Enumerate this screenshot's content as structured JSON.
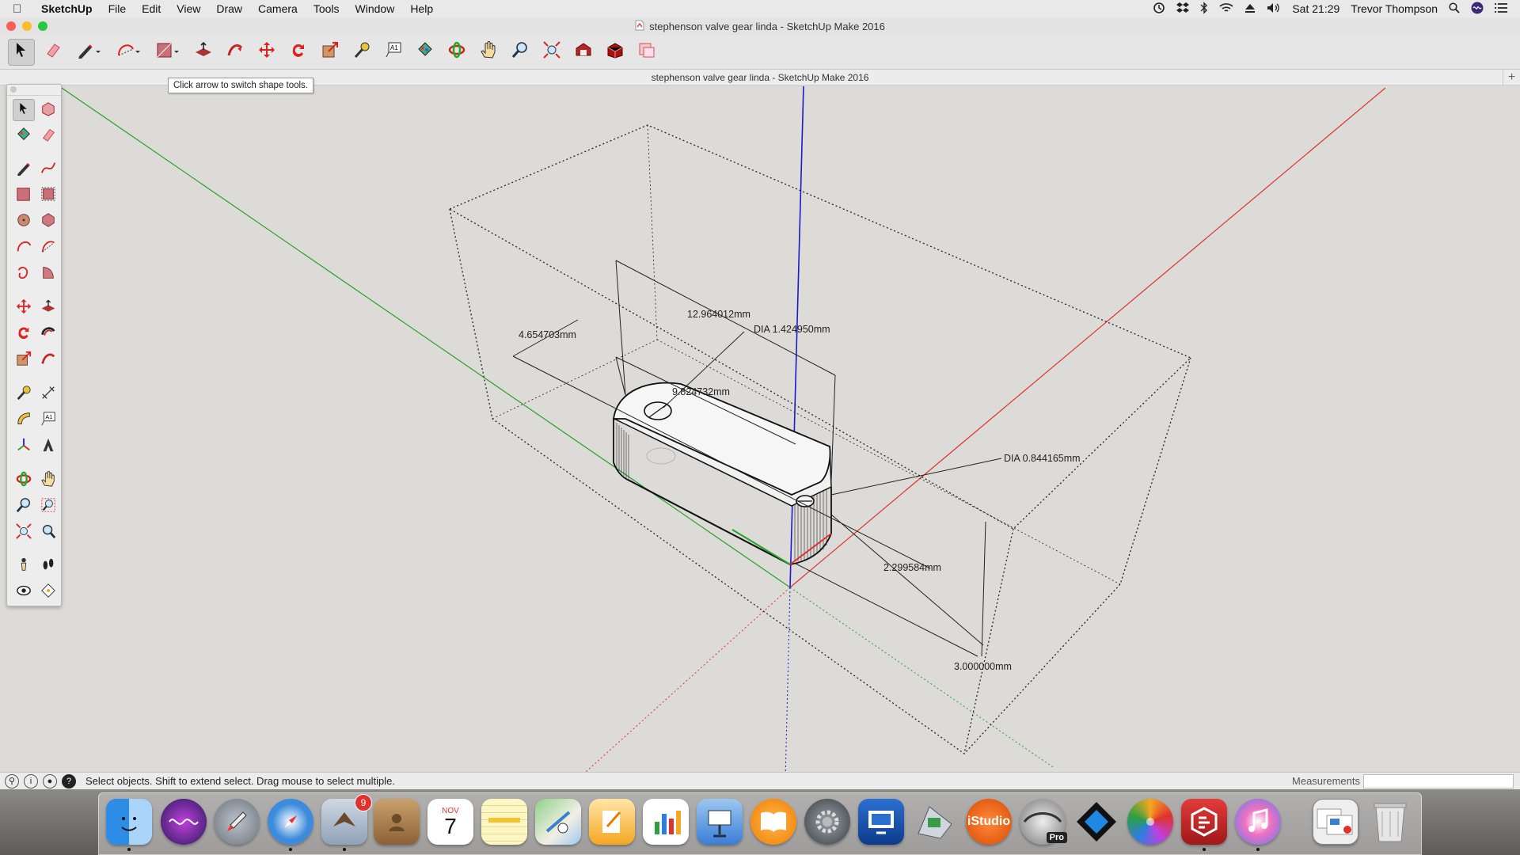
{
  "menubar": {
    "app_name": "SketchUp",
    "items": [
      "File",
      "Edit",
      "View",
      "Draw",
      "Camera",
      "Tools",
      "Window",
      "Help"
    ],
    "clock": "Sat 21:29",
    "user": "Trevor Thompson"
  },
  "window": {
    "title": "stephenson valve gear linda - SketchUp Make 2016",
    "doc_title": "stephenson valve gear linda - SketchUp Make 2016"
  },
  "tooltip": "Click arrow to switch shape tools.",
  "toolbar": {
    "tools": [
      "select-icon",
      "eraser-icon",
      "pencil-icon",
      "arc-icon",
      "rectangle-icon",
      "push-pull-icon",
      "follow-me-icon",
      "move-icon",
      "rotate-icon",
      "scale-icon",
      "tape-measure-icon",
      "text-icon",
      "paint-bucket-icon",
      "orbit-icon",
      "pan-icon",
      "zoom-icon",
      "zoom-extents-icon",
      "warehouse-icon",
      "extension-warehouse-icon",
      "layout-icon"
    ]
  },
  "dimensions": {
    "d1": "12.964012mm",
    "d2": "DIA 1.424950mm",
    "d3": "4.654703mm",
    "d4": "9.824732mm",
    "d5": "DIA 0.844165mm",
    "d6": "2.299584mm",
    "d7": "3.000000mm"
  },
  "statusbar": {
    "message": "Select objects. Shift to extend select. Drag mouse to select multiple.",
    "measurements_label": "Measurements",
    "measurements_value": ""
  },
  "dock": {
    "calendar_month": "NOV",
    "calendar_day": "7",
    "mail_badge": "9",
    "istudio_label": "iStudio",
    "pro_label": "Pro"
  },
  "colors": {
    "axis_red": "#e03030",
    "axis_green": "#2aa02a",
    "axis_blue": "#1a1acc",
    "viewport_bg": "#dcdbd7"
  }
}
